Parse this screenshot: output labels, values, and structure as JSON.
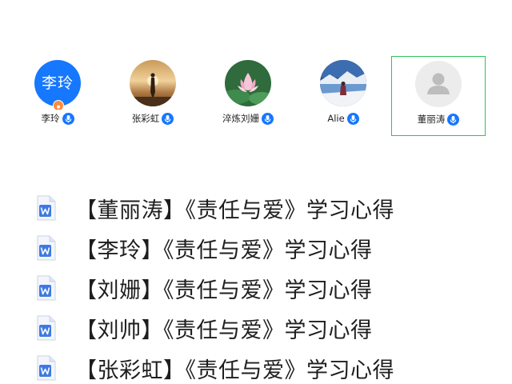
{
  "participants": [
    {
      "name": "李玲",
      "avatar_text": "李玲",
      "avatar_type": "text",
      "host": true,
      "selected": false,
      "mic_icon": "microphone-icon"
    },
    {
      "name": "张彩虹",
      "avatar_type": "photo",
      "photo": "sunset-silhouette",
      "host": false,
      "selected": false,
      "mic_icon": "microphone-icon"
    },
    {
      "name": "淬炼刘姗",
      "avatar_type": "photo",
      "photo": "lotus-flower",
      "host": false,
      "selected": false,
      "mic_icon": "microphone-icon"
    },
    {
      "name": "Alie",
      "avatar_type": "photo",
      "photo": "snowy-lake",
      "host": false,
      "selected": false,
      "mic_icon": "microphone-icon"
    },
    {
      "name": "董丽涛",
      "avatar_type": "placeholder",
      "host": false,
      "selected": true,
      "mic_icon": "microphone-icon"
    }
  ],
  "documents": [
    {
      "title": "【董丽涛】《责任与爱》学习心得",
      "icon": "word-document-icon"
    },
    {
      "title": "【李玲】《责任与爱》学习心得",
      "icon": "word-document-icon"
    },
    {
      "title": "【刘姗】《责任与爱》学习心得",
      "icon": "word-document-icon"
    },
    {
      "title": "【刘帅】《责任与爱》学习心得",
      "icon": "word-document-icon"
    },
    {
      "title": "【张彩虹】《责任与爱》学习心得",
      "icon": "word-document-icon"
    }
  ],
  "colors": {
    "accent_blue": "#1677ff",
    "selected_border": "#2fc25b",
    "host_badge": "#ff8a3d",
    "word_blue": "#3d7ae5"
  }
}
